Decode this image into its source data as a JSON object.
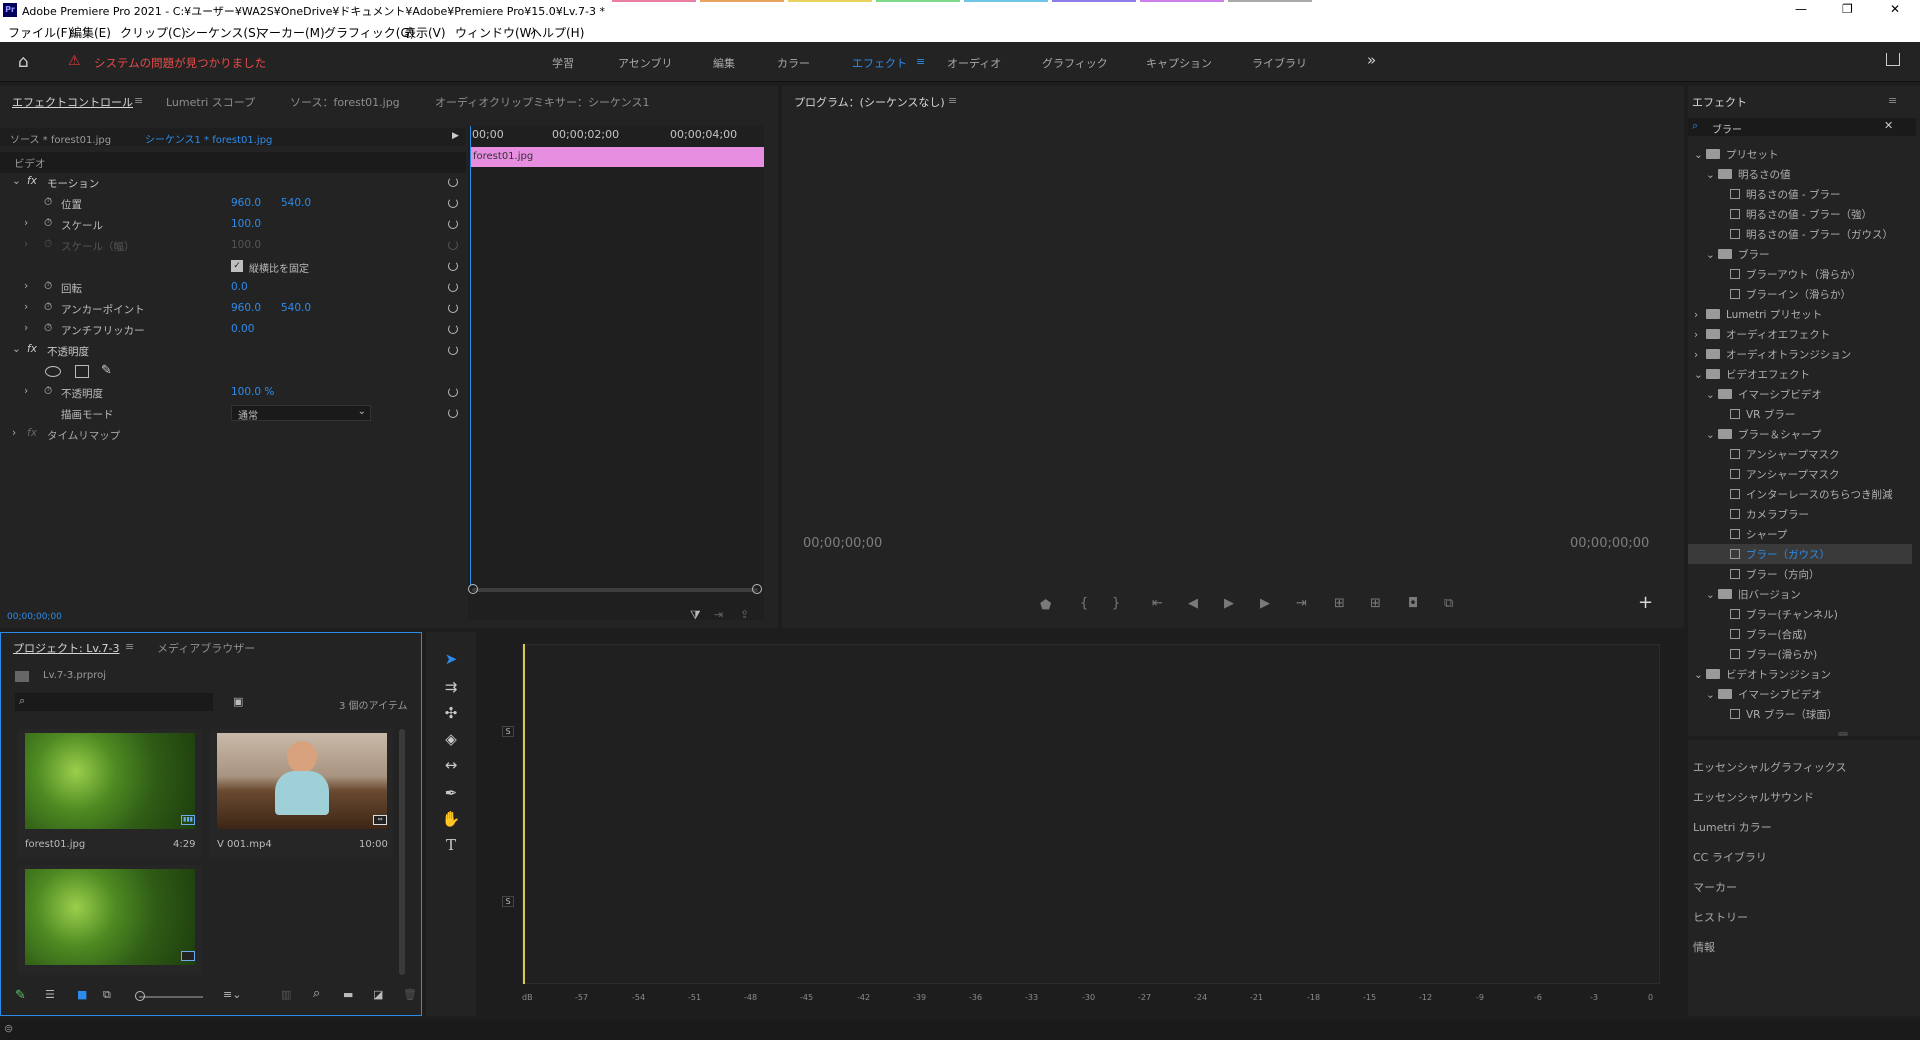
{
  "window": {
    "title": "Adobe Premiere Pro 2021 - C:¥ユーザー¥WA2S¥OneDrive¥ドキュメント¥Adobe¥Premiere Pro¥15.0¥Lv.7-3 *",
    "controls": [
      "—",
      "❐",
      "✕"
    ]
  },
  "menu": [
    "ファイル(F)",
    "編集(E)",
    "クリップ(C)",
    "シーケンス(S)",
    "マーカー(M)",
    "グラフィック(G)",
    "表示(V)",
    "ウィンドウ(W)",
    "ヘルプ(H)"
  ],
  "accent": "#2d8ceb",
  "workspace": {
    "warning": "システムの問題が見つかりました",
    "tabs": [
      "学習",
      "アセンブリ",
      "編集",
      "カラー",
      "エフェクト",
      "オーディオ",
      "グラフィック",
      "キャプション",
      "ライブラリ"
    ],
    "active": "エフェクト",
    "more": "»"
  },
  "effect_controls": {
    "tabs": [
      "エフェクトコントロール",
      "Lumetri スコープ",
      "ソース：forest01.jpg",
      "オーディオクリップミキサー：シーケンス1"
    ],
    "source_label": "ソース * forest01.jpg",
    "sequence_label": "シーケンス1 * forest01.jpg",
    "ruler": [
      "00;00",
      "00;00;02;00",
      "00;00;04;00"
    ],
    "clip": "forest01.jpg",
    "video_header": "ビデオ",
    "motion": "モーション",
    "position": {
      "label": "位置",
      "x": "960.0",
      "y": "540.0"
    },
    "scale": {
      "label": "スケール",
      "value": "100.0"
    },
    "scale_w": {
      "label": "スケール（幅）",
      "value": "100.0"
    },
    "uniform_scale": "縦横比を固定",
    "rotation": {
      "label": "回転",
      "value": "0.0"
    },
    "anchor": {
      "label": "アンカーポイント",
      "x": "960.0",
      "y": "540.0"
    },
    "flicker": {
      "label": "アンチフリッカー",
      "value": "0.00"
    },
    "opacity_group": "不透明度",
    "opacity": {
      "label": "不透明度",
      "value": "100.0 %"
    },
    "blend": {
      "label": "描画モード",
      "value": "通常"
    },
    "time_remap": "タイムリマップ",
    "timecode": "00;00;00;00"
  },
  "program": {
    "title": "プログラム：(シーケンスなし)",
    "tc_left": "00;00;00;00",
    "tc_right": "00;00;00;00",
    "add": "+"
  },
  "project": {
    "tabs": [
      "プロジェクト: Lv.7-3",
      "メディアブラウザー"
    ],
    "file": "Lv.7-3.prproj",
    "count": "3 個のアイテム",
    "items": [
      {
        "name": "forest01.jpg",
        "dur": "4:29"
      },
      {
        "name": "V 001.mp4",
        "dur": "10:00"
      },
      {
        "name": "",
        "dur": ""
      }
    ]
  },
  "timeline": {
    "ticks": [
      "dB",
      "-57",
      "-54",
      "-51",
      "-48",
      "-45",
      "-42",
      "-39",
      "-36",
      "-33",
      "-30",
      "-27",
      "-24",
      "-21",
      "-18",
      "-15",
      "-12",
      "-9",
      "-6",
      "-3",
      "0"
    ],
    "s": "S"
  },
  "effects": {
    "title": "エフェクト",
    "search": "ブラー",
    "tree": [
      {
        "d": 0,
        "t": "f",
        "label": "プリセット"
      },
      {
        "d": 1,
        "t": "f",
        "label": "明るさの値"
      },
      {
        "d": 2,
        "t": "x",
        "label": "明るさの値 - ブラー"
      },
      {
        "d": 2,
        "t": "x",
        "label": "明るさの値 - ブラー（強）"
      },
      {
        "d": 2,
        "t": "x",
        "label": "明るさの値 - ブラー（ガウス）"
      },
      {
        "d": 1,
        "t": "f",
        "label": "ブラー"
      },
      {
        "d": 2,
        "t": "x",
        "label": "ブラーアウト（滑らか）"
      },
      {
        "d": 2,
        "t": "x",
        "label": "ブラーイン（滑らか）"
      },
      {
        "d": 0,
        "t": "f",
        "label": "Lumetri プリセット"
      },
      {
        "d": 0,
        "t": "f",
        "label": "オーディオエフェクト"
      },
      {
        "d": 0,
        "t": "f",
        "label": "オーディオトランジション"
      },
      {
        "d": 0,
        "t": "f",
        "label": "ビデオエフェクト"
      },
      {
        "d": 1,
        "t": "f",
        "label": "イマーシブビデオ"
      },
      {
        "d": 2,
        "t": "x",
        "label": "VR ブラー"
      },
      {
        "d": 1,
        "t": "f",
        "label": "ブラー＆シャープ"
      },
      {
        "d": 2,
        "t": "x",
        "label": "アンシャープマスク"
      },
      {
        "d": 2,
        "t": "x",
        "label": "アンシャープマスク"
      },
      {
        "d": 2,
        "t": "x",
        "label": "インターレースのちらつき削減"
      },
      {
        "d": 2,
        "t": "x",
        "label": "カメラブラー"
      },
      {
        "d": 2,
        "t": "x",
        "label": "シャープ"
      },
      {
        "d": 2,
        "t": "x",
        "label": "ブラー（ガウス）",
        "sel": true
      },
      {
        "d": 2,
        "t": "x",
        "label": "ブラー（方向）"
      },
      {
        "d": 1,
        "t": "f",
        "label": "旧バージョン"
      },
      {
        "d": 2,
        "t": "x",
        "label": "ブラー(チャンネル)"
      },
      {
        "d": 2,
        "t": "x",
        "label": "ブラー(合成)"
      },
      {
        "d": 2,
        "t": "x",
        "label": "ブラー(滑らか)"
      },
      {
        "d": 0,
        "t": "f",
        "label": "ビデオトランジション"
      },
      {
        "d": 1,
        "t": "f",
        "label": "イマーシブビデオ"
      },
      {
        "d": 2,
        "t": "x",
        "label": "VR ブラー（球面）"
      }
    ],
    "panels": [
      "エッセンシャルグラフィックス",
      "エッセンシャルサウンド",
      "Lumetri カラー",
      "CC ライブラリ",
      "マーカー",
      "ヒストリー",
      "情報"
    ]
  }
}
